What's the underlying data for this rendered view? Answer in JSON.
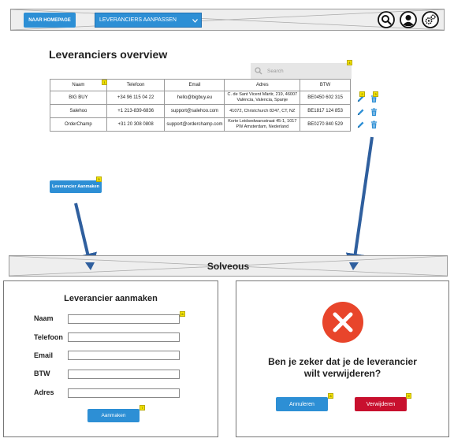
{
  "navbar": {
    "home_button": "NAAR HOMEPAGE",
    "select_value": "LEVERANCIERS AANPASSEN"
  },
  "overview": {
    "title": "Leveranciers overview",
    "search_placeholder": "Search",
    "columns": [
      "Naam",
      "Telefoon",
      "Email",
      "Adres",
      "BTW"
    ],
    "rows": [
      {
        "naam": "BIG BUY",
        "telefoon": "+34 96 115 04 22",
        "email": "hello@bigbuy.eu",
        "adres": "C. de Sant Vicent Màrtir, 219, 46007 València, Valencia, Spanje",
        "btw": "BE0450 602 315"
      },
      {
        "naam": "Salehoo",
        "telefoon": "+1 213-839-6836",
        "email": "support@salehoo.com",
        "adres": "41072, Christchurch 8247, CT, NZ",
        "btw": "BE1817 124 853"
      },
      {
        "naam": "OrderChamp",
        "telefoon": "+31 20 308 0808",
        "email": "support@orderchamp.com",
        "adres": "Korte Leidsedwarsstraat 45-1, 1017 PW Amsterdam, Nederland",
        "btw": "BE0270 840 529"
      }
    ],
    "create_button": "Leverancier Aanmaken"
  },
  "footer_bar": {
    "label": "Solveous"
  },
  "create_form": {
    "title": "Leverancier aanmaken",
    "fields": [
      "Naam",
      "Telefoon",
      "Email",
      "BTW",
      "Adres"
    ],
    "submit": "Aanmaken"
  },
  "delete_dialog": {
    "line1": "Ben je zeker dat je de leverancier",
    "line2": "wilt verwijderen?",
    "cancel": "Annuleren",
    "confirm": "Verwijderen"
  },
  "badges": [
    "1",
    "2",
    "3",
    "4",
    "5",
    "6",
    "7",
    "8",
    "9"
  ],
  "icons": {
    "search": "search-icon",
    "user": "user-icon",
    "settings": "gears-icon",
    "edit": "pencil-icon",
    "delete": "trash-icon",
    "error": "error-x-icon",
    "chevron": "chevron-down-icon"
  },
  "colors": {
    "primary": "#2d8fd5",
    "danger": "#c8102e",
    "error_circle": "#e8452b",
    "badge": "#f4e400",
    "arrow": "#2f5f9e"
  }
}
